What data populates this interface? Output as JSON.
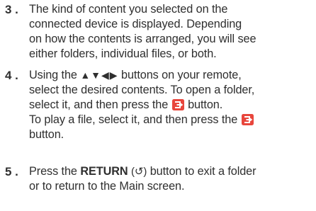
{
  "steps": [
    {
      "number": "3 .",
      "lines": [
        "The kind of content you selected on the",
        "connected device is displayed. Depending",
        "on how the contents is arranged, you will see",
        "either folders, individual files, or both."
      ]
    },
    {
      "number": "4 .",
      "line1_pre": "Using the",
      "arrows": "▲▼◀▶",
      "line1_post": "buttons on your remote,",
      "line2": "select the desired contents. To open a folder,",
      "line3_pre": "select it, and then press the",
      "line3_post": "button.",
      "line4": "To play a file, select it, and then press the",
      "line5": "button."
    },
    {
      "number": "5 .",
      "line1_pre": "Press the",
      "line1_bold": "RETURN",
      "line1_icon": "(↺)",
      "line1_post": "button to exit a folder",
      "line2": "or to return to the Main screen."
    }
  ],
  "icons": {
    "enter": "enter-button-icon",
    "enter_color": "#e8463c"
  }
}
